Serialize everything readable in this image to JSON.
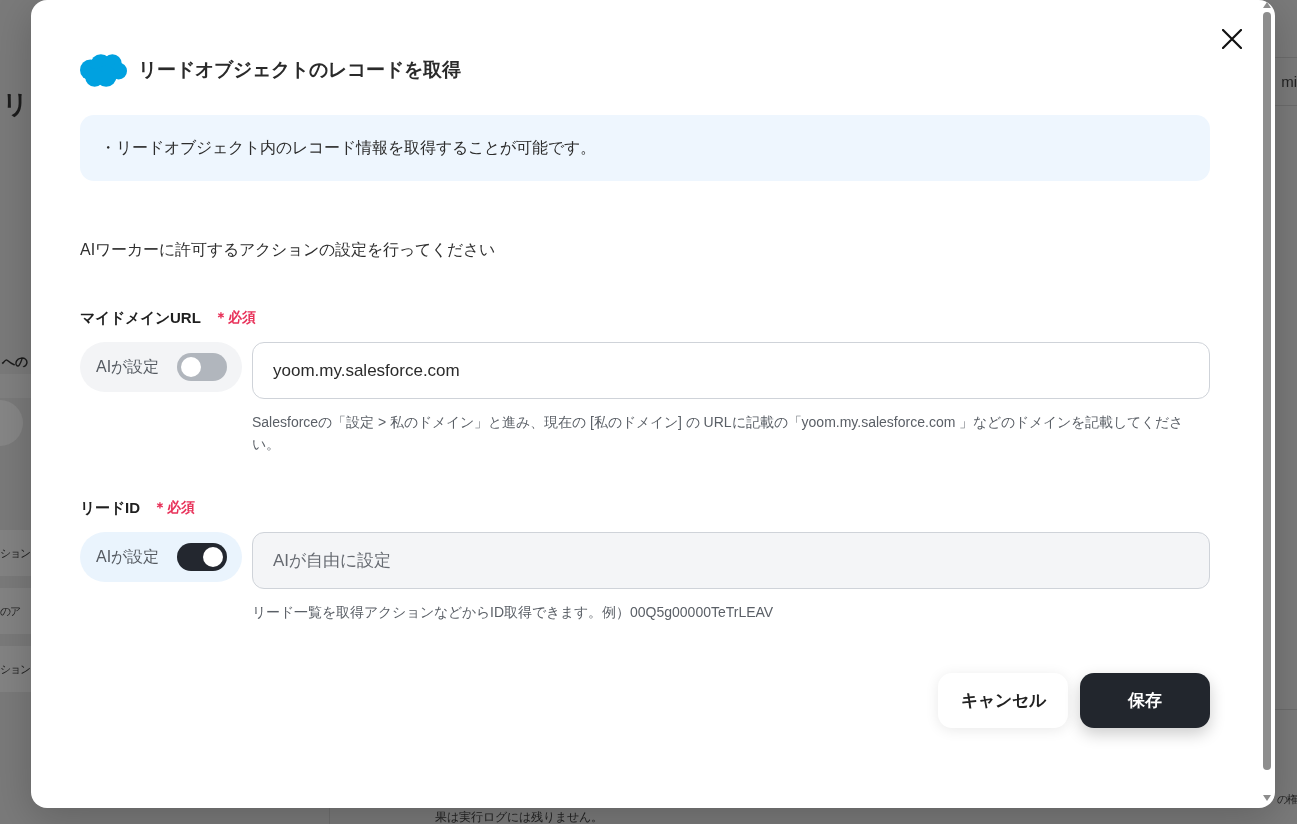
{
  "background": {
    "heading": "リ",
    "section": "への",
    "list_items": [
      "ション",
      "のア",
      "ション"
    ],
    "top_right": "mi",
    "bottom_right": "の権",
    "footer_note": "果は実行ログには残りません。"
  },
  "modal": {
    "title": "リードオブジェクトのレコードを取得",
    "info": "・リードオブジェクト内のレコード情報を取得することが可能です。",
    "instruction": "AIワーカーに許可するアクションの設定を行ってください",
    "fields": [
      {
        "label": "マイドメインURL",
        "required_mark": "＊必須",
        "ai_toggle": {
          "label": "AIが設定",
          "on": false
        },
        "value": "yoom.my.salesforce.com",
        "help": "Salesforceの「設定 > 私のドメイン」と進み、現在の [私のドメイン] の URLに記載の「yoom.my.salesforce.com 」などのドメインを記載してください。"
      },
      {
        "label": "リードID",
        "required_mark": "＊必須",
        "ai_toggle": {
          "label": "AIが設定",
          "on": true
        },
        "placeholder": "AIが自由に設定",
        "help": "リード一覧を取得アクションなどからID取得できます。例）00Q5g00000TeTrLEAV"
      }
    ],
    "buttons": [
      {
        "label": "キャンセル",
        "kind": "secondary"
      },
      {
        "label": "保存",
        "kind": "primary"
      }
    ]
  }
}
